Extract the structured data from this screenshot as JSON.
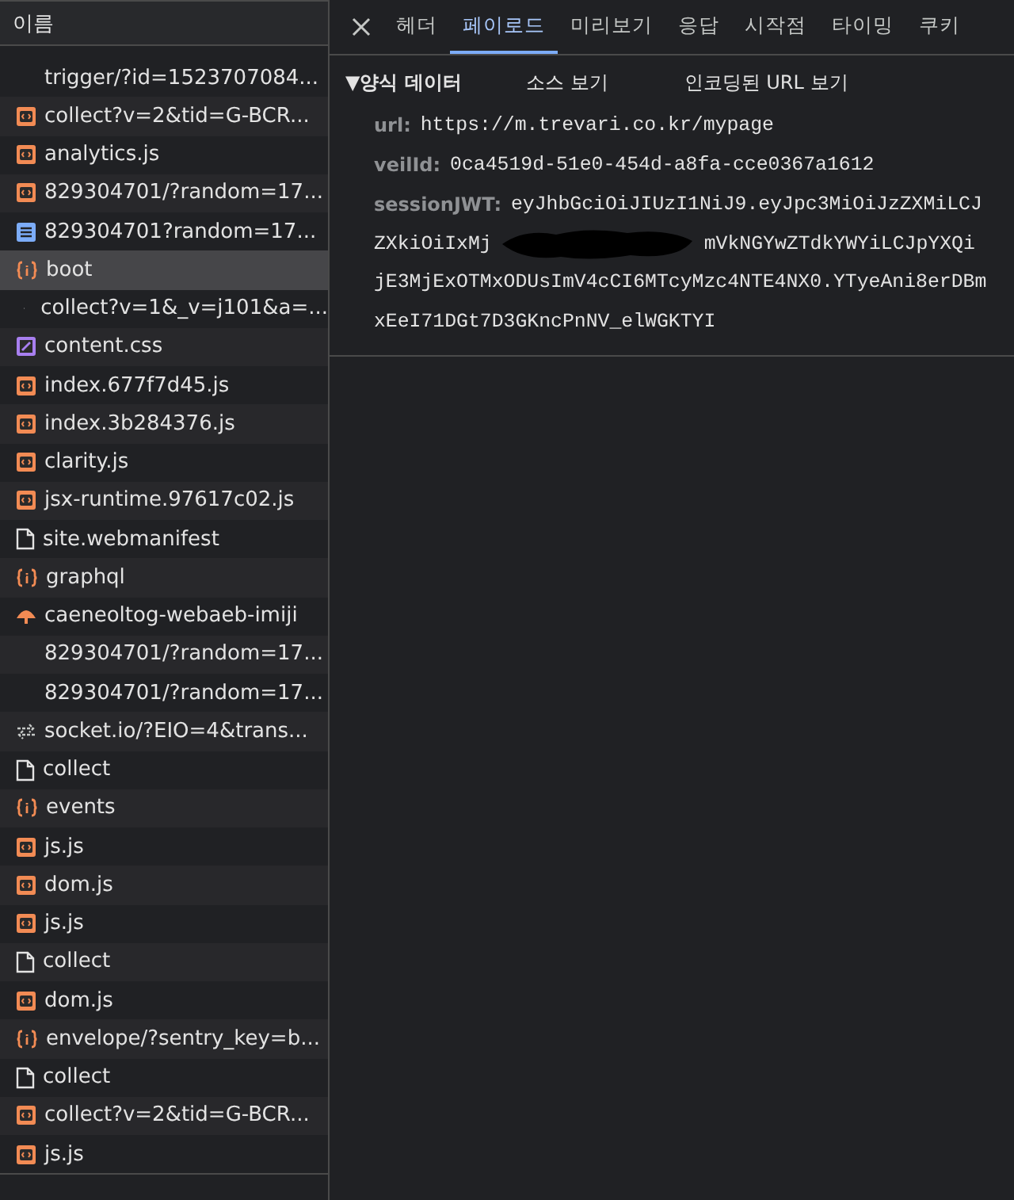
{
  "name_column": {
    "header": "이름"
  },
  "requests": [
    {
      "name": "trigger/?id=1523707084...",
      "kind": "blank",
      "selected": false
    },
    {
      "name": "collect?v=2&tid=G-BCR...",
      "kind": "script",
      "selected": false
    },
    {
      "name": "analytics.js",
      "kind": "script",
      "selected": false
    },
    {
      "name": "829304701/?random=17...",
      "kind": "script",
      "selected": false
    },
    {
      "name": "829304701?random=17...",
      "kind": "document",
      "selected": false
    },
    {
      "name": "boot",
      "kind": "fetch",
      "selected": true
    },
    {
      "name": "collect?v=1&_v=j101&a=...",
      "kind": "dot",
      "selected": false
    },
    {
      "name": "content.css",
      "kind": "stylesheet",
      "selected": false
    },
    {
      "name": "index.677f7d45.js",
      "kind": "script",
      "selected": false
    },
    {
      "name": "index.3b284376.js",
      "kind": "script",
      "selected": false
    },
    {
      "name": "clarity.js",
      "kind": "script",
      "selected": false
    },
    {
      "name": "jsx-runtime.97617c02.js",
      "kind": "script",
      "selected": false
    },
    {
      "name": "site.webmanifest",
      "kind": "file",
      "selected": false
    },
    {
      "name": "graphql",
      "kind": "fetch",
      "selected": false
    },
    {
      "name": "caeneoltog-webaeb-imiji",
      "kind": "image",
      "selected": false
    },
    {
      "name": "829304701/?random=17...",
      "kind": "blank",
      "selected": false
    },
    {
      "name": "829304701/?random=17...",
      "kind": "blank",
      "selected": false
    },
    {
      "name": "socket.io/?EIO=4&trans...",
      "kind": "websocket",
      "selected": false
    },
    {
      "name": "collect",
      "kind": "file",
      "selected": false
    },
    {
      "name": "events",
      "kind": "fetch",
      "selected": false
    },
    {
      "name": "js.js",
      "kind": "script",
      "selected": false
    },
    {
      "name": "dom.js",
      "kind": "script",
      "selected": false
    },
    {
      "name": "js.js",
      "kind": "script",
      "selected": false
    },
    {
      "name": "collect",
      "kind": "file",
      "selected": false
    },
    {
      "name": "dom.js",
      "kind": "script",
      "selected": false
    },
    {
      "name": "envelope/?sentry_key=b...",
      "kind": "fetch",
      "selected": false
    },
    {
      "name": "collect",
      "kind": "file",
      "selected": false
    },
    {
      "name": "collect?v=2&tid=G-BCR...",
      "kind": "script",
      "selected": false
    },
    {
      "name": "js.js",
      "kind": "script",
      "selected": false
    }
  ],
  "detail_tabs": [
    {
      "label": "헤더",
      "selected": false
    },
    {
      "label": "페이로드",
      "selected": true
    },
    {
      "label": "미리보기",
      "selected": false
    },
    {
      "label": "응답",
      "selected": false
    },
    {
      "label": "시작점",
      "selected": false
    },
    {
      "label": "타이밍",
      "selected": false
    },
    {
      "label": "쿠키",
      "selected": false
    }
  ],
  "payload": {
    "section_title": "▼양식 데이터",
    "view_source": "소스 보기",
    "view_encoded": "인코딩된 URL 보기",
    "fields": [
      {
        "key": "url:",
        "lines": [
          [
            {
              "kind": "text",
              "text": "https://m.trevari.co.kr/mypage"
            }
          ]
        ]
      },
      {
        "key": "veilId:",
        "lines": [
          [
            {
              "kind": "text",
              "text": "0ca4519d-51e0-454d-a8fa-cce0367a1612"
            }
          ]
        ]
      },
      {
        "key": "sessionJWT:",
        "lines": [
          [
            {
              "kind": "text",
              "text": "eyJhbGciOiJIUzI1NiJ9.eyJpc3MiOiJzZXMiLCJ"
            }
          ],
          [
            {
              "kind": "text",
              "text": "ZXkiOiIxMj"
            },
            {
              "kind": "redacted"
            },
            {
              "kind": "text",
              "text": "mVkNGYwZTdkYWYiLCJpYXQi"
            }
          ],
          [
            {
              "kind": "text",
              "text": "jE3MjExOTMxODUsImV4cCI6MTcyMzc4NTE4NX0.YTyeAni8erDBm"
            }
          ],
          [
            {
              "kind": "text",
              "text": "xEeI71DGt7D3GKncPnNV_elWGKTYI"
            }
          ]
        ]
      }
    ]
  }
}
